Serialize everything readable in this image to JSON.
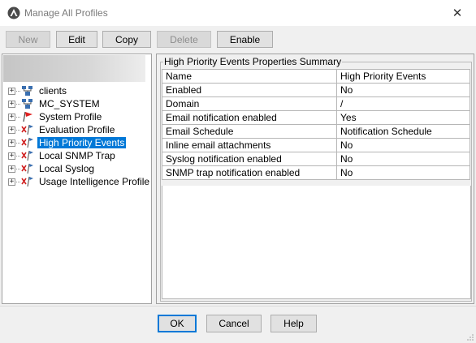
{
  "window": {
    "title": "Manage All Profiles"
  },
  "toolbar": {
    "new_label": "New",
    "edit_label": "Edit",
    "copy_label": "Copy",
    "delete_label": "Delete",
    "enable_label": "Enable"
  },
  "tree": {
    "items": [
      {
        "label": "clients",
        "icon": "group-icon"
      },
      {
        "label": "MC_SYSTEM",
        "icon": "group-icon"
      },
      {
        "label": "System Profile",
        "icon": "red-flag-icon"
      },
      {
        "label": "Evaluation Profile",
        "icon": "disabled-profile-icon"
      },
      {
        "label": "High Priority Events",
        "icon": "disabled-profile-icon",
        "selected": true
      },
      {
        "label": "Local SNMP Trap",
        "icon": "disabled-profile-icon"
      },
      {
        "label": "Local Syslog",
        "icon": "disabled-profile-icon"
      },
      {
        "label": "Usage Intelligence Profile",
        "icon": "disabled-profile-icon"
      }
    ]
  },
  "summary": {
    "group_title": "High Priority Events Properties Summary",
    "rows": [
      {
        "key": "Name",
        "value": "High Priority Events"
      },
      {
        "key": "Enabled",
        "value": "No"
      },
      {
        "key": "Domain",
        "value": "/"
      },
      {
        "key": "Email notification enabled",
        "value": "Yes"
      },
      {
        "key": "Email Schedule",
        "value": "Notification Schedule"
      },
      {
        "key": "Inline email attachments",
        "value": "No"
      },
      {
        "key": "Syslog notification enabled",
        "value": "No"
      },
      {
        "key": "SNMP trap notification enabled",
        "value": "No"
      }
    ]
  },
  "footer": {
    "ok_label": "OK",
    "cancel_label": "Cancel",
    "help_label": "Help"
  },
  "colors": {
    "selection": "#0078d7",
    "flag_red": "#e02020",
    "disabled_x": "#d02020"
  }
}
